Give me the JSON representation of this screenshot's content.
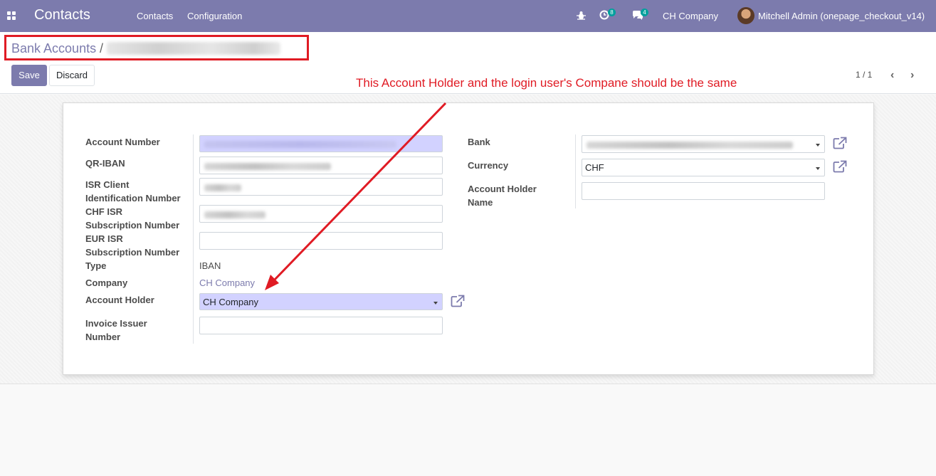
{
  "navbar": {
    "app_title": "Contacts",
    "menu": [
      "Contacts",
      "Configuration"
    ],
    "activity_count": "8",
    "messages_count": "4",
    "company": "CH Company",
    "user": "Mitchell Admin (onepage_checkout_v14)"
  },
  "breadcrumb": {
    "parent": "Bank Accounts",
    "separator": "/"
  },
  "actions": {
    "save": "Save",
    "discard": "Discard"
  },
  "pager": {
    "value": "1 / 1"
  },
  "annotation": "This Account Holder and the login user's Compane should be the same",
  "form": {
    "labels": {
      "account_number": "Account Number",
      "qr_iban": "QR-IBAN",
      "isr_client_1": "ISR Client",
      "isr_client_2": "Identification Number",
      "chf_isr_1": "CHF ISR",
      "chf_isr_2": "Subscription Number",
      "eur_isr_1": "EUR ISR",
      "eur_isr_2": "Subscription Number",
      "type": "Type",
      "company": "Company",
      "account_holder": "Account Holder",
      "invoice_issuer_1": "Invoice Issuer",
      "invoice_issuer_2": "Number",
      "bank": "Bank",
      "currency": "Currency",
      "account_holder_name_1": "Account Holder",
      "account_holder_name_2": "Name"
    },
    "values": {
      "type": "IBAN",
      "company": "CH Company",
      "account_holder": "CH Company",
      "currency": "CHF",
      "account_holder_name": "",
      "invoice_issuer_number": "",
      "eur_isr": ""
    }
  },
  "colors": {
    "brand": "#7c7bad",
    "annotation": "#e01b24",
    "required_field": "#d2d2ff"
  }
}
